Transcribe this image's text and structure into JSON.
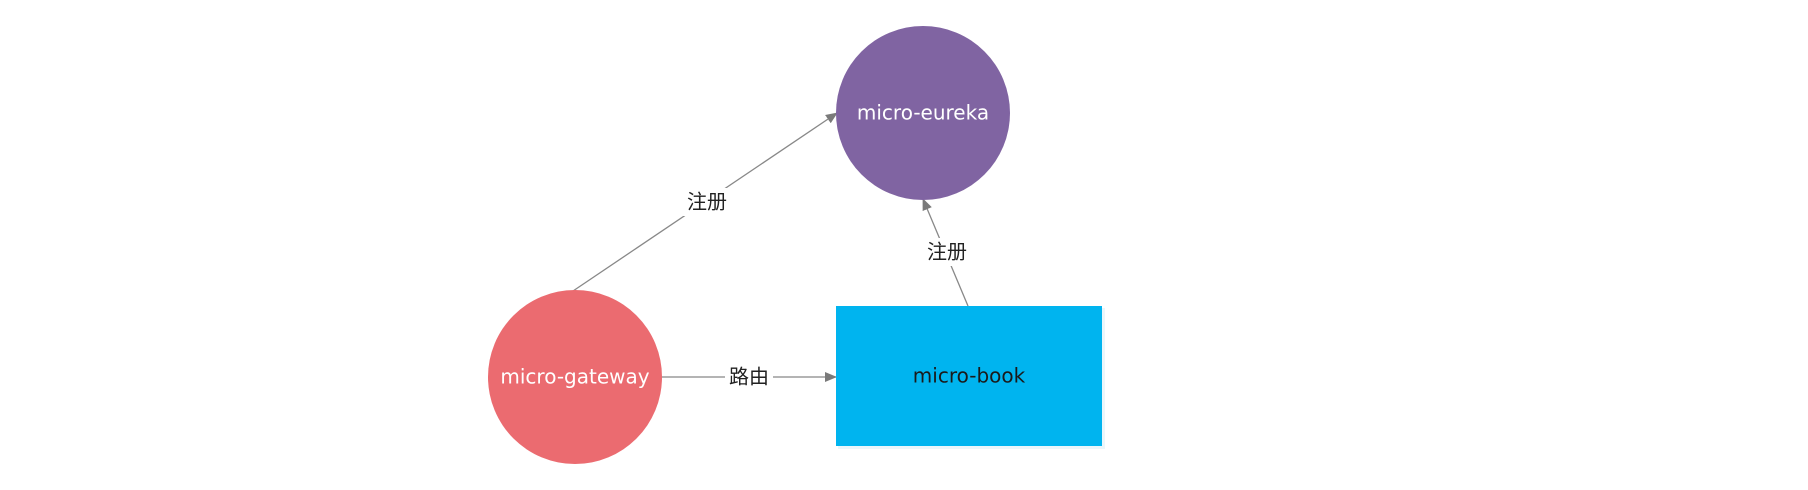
{
  "nodes": {
    "eureka": {
      "label": "micro-eureka",
      "shape": "circle",
      "fill": "#8064A2",
      "text_color": "#ffffff"
    },
    "gateway": {
      "label": "micro-gateway",
      "shape": "circle",
      "fill": "#EB6B70",
      "text_color": "#ffffff"
    },
    "book": {
      "label": "micro-book",
      "shape": "rectangle",
      "fill": "#00B4EF",
      "text_color": "#1a1a1a"
    }
  },
  "edges": [
    {
      "from": "micro-gateway",
      "to": "micro-eureka",
      "label": "注册"
    },
    {
      "from": "micro-book",
      "to": "micro-eureka",
      "label": "注册"
    },
    {
      "from": "micro-gateway",
      "to": "micro-book",
      "label": "路由"
    }
  ],
  "colors": {
    "edge": "#888888",
    "edge_label_bg": "#ffffff"
  }
}
